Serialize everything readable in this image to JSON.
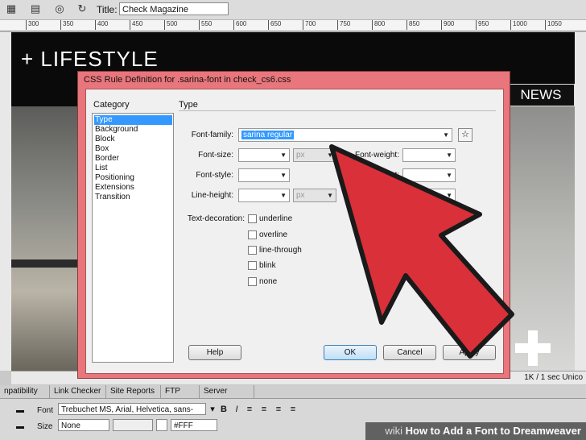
{
  "toolbar": {
    "title_label": "Title:",
    "title_value": "Check Magazine"
  },
  "ruler": {
    "ticks": [
      "300",
      "350",
      "400",
      "450",
      "500",
      "550",
      "600",
      "650",
      "700",
      "750",
      "800",
      "850",
      "900",
      "950",
      "1000",
      "1050"
    ]
  },
  "design": {
    "headline": "+ LIFESTYLE",
    "news_tab": "NEWS"
  },
  "statusbar": {
    "text": "1K / 1 sec  Unico"
  },
  "dialog": {
    "title": "CSS Rule Definition for .sarina-font in check_cs6.css",
    "category_label": "Category",
    "section_heading": "Type",
    "categories": [
      "Type",
      "Background",
      "Block",
      "Box",
      "Border",
      "List",
      "Positioning",
      "Extensions",
      "Transition"
    ],
    "fields": {
      "font_family_label": "Font-family:",
      "font_family_value": "sarina regular",
      "font_size_label": "Font-size:",
      "font_size_unit": "px",
      "font_weight_label": "Font-weight:",
      "font_style_label": "Font-style:",
      "font_variant_label_partial": "t:",
      "line_height_label": "Line-height:",
      "line_height_unit": "px",
      "text_decoration_label": "Text-decoration:"
    },
    "decorations": [
      "underline",
      "overline",
      "line-through",
      "blink",
      "none"
    ],
    "buttons": {
      "help": "Help",
      "ok": "OK",
      "cancel": "Cancel",
      "apply": "Apply"
    }
  },
  "panels": {
    "tabs": [
      "npatibility",
      "Link Checker",
      "Site Reports",
      "FTP Log",
      "Server Debug"
    ],
    "font_label": "Font",
    "font_value": "Trebuchet MS, Arial, Helvetica, sans-",
    "size_label": "Size",
    "size_value": "None",
    "color_value": "#FFF"
  },
  "watermark": {
    "prefix": "wiki",
    "text": "How to Add a Font to Dreamweaver"
  },
  "colors": {
    "dialog_frame": "#e8767c",
    "arrow": "#d9303a",
    "selection": "#3399ff"
  }
}
